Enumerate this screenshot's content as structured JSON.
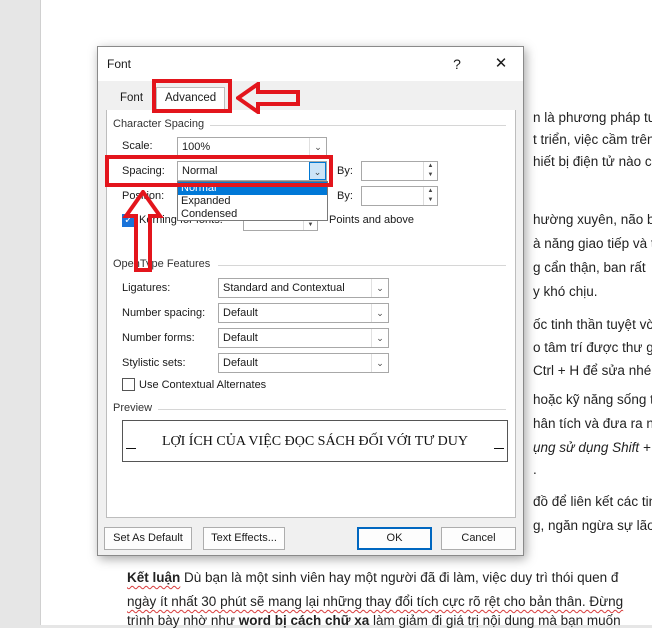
{
  "document": {
    "lines": [
      {
        "text": "n là phương pháp tu",
        "cls": ""
      },
      {
        "text": "t triển, việc cầm trên",
        "cls": ""
      },
      {
        "text": "hiết bị điện tử nào c",
        "cls": ""
      },
      {
        "text": "hường xuyên, não bo",
        "cls": ""
      },
      {
        "text": "à năng giao tiếp và t",
        "cls": ""
      },
      {
        "text": "g cẩn thận, ban rất",
        "cls": ""
      },
      {
        "text": "y khó chịu.",
        "cls": ""
      },
      {
        "text": "ốc tinh thần tuyệt vời",
        "cls": ""
      },
      {
        "text": "o tâm trí được thư g",
        "cls": ""
      },
      {
        "text": "Ctrl + H để sửa nhé",
        "cls": ""
      },
      {
        "text": "hoặc kỹ năng sống t",
        "cls": ""
      },
      {
        "text": "hân tích và đưa ra n",
        "cls": ""
      },
      {
        "text": "ụng sử dụng Shift + E",
        "cls": "ital"
      },
      {
        "text": ".",
        "cls": ""
      },
      {
        "text": "đồ để liên kết các tin",
        "cls": ""
      },
      {
        "text": "g, ngăn ngừa sự lão",
        "cls": ""
      }
    ],
    "conclusion_label": "Kết luận",
    "conclusion_text": " Dù bạn là một sinh viên hay một người đã đi làm, việc duy trì thói quen đ",
    "line2": "ngày ít nhất 30 phút sẽ mang lại những thay đổi tích cực rõ rệt cho bản thân. Đừng",
    "line3_a": "trình bày nhờ như ",
    "line3_b": "word bị cách chữ xa",
    "line3_c": " làm giảm đi giá trị nội dung mà bạn muốn"
  },
  "dialog": {
    "title": "Font",
    "help": "?",
    "close": "✕",
    "tabs": {
      "font": "Font",
      "advanced": "Advanced"
    },
    "character_spacing": {
      "heading": "Character Spacing",
      "scale_label": "Scale:",
      "scale_value": "100%",
      "spacing_label": "Spacing:",
      "spacing_value": "Normal",
      "spacing_options": [
        "Normal",
        "Expanded",
        "Condensed"
      ],
      "by_label": "By:",
      "position_label": "Position:",
      "position_by_label": "By:",
      "kerning_label": "Kerning for fonts:",
      "points_label": "Points and above"
    },
    "opentype": {
      "heading": "OpenType Features",
      "ligatures_label": "Ligatures:",
      "ligatures_value": "Standard and Contextual",
      "number_spacing_label": "Number spacing:",
      "number_spacing_value": "Default",
      "number_forms_label": "Number forms:",
      "number_forms_value": "Default",
      "stylistic_sets_label": "Stylistic sets:",
      "stylistic_sets_value": "Default",
      "contextual_label": "Use Contextual Alternates"
    },
    "preview": {
      "heading": "Preview",
      "text": "LỢI ÍCH CỦA VIỆC ĐỌC SÁCH ĐỐI VỚI TƯ DUY"
    },
    "buttons": {
      "set_default": "Set As Default",
      "text_effects": "Text Effects...",
      "ok": "OK",
      "cancel": "Cancel"
    }
  },
  "annotation_color": "#e3151c"
}
